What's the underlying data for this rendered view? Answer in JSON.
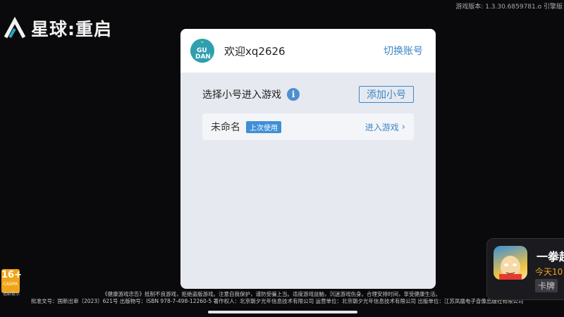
{
  "background": {
    "app_title": "星球:重启",
    "version_text": "游戏版本: 1.3.30.6859781.o  引擎版"
  },
  "dialog": {
    "welcome": "欢迎xq2626",
    "switch_account": "切换账号",
    "avatar_icon": "gudian-logo-icon",
    "section_title": "选择小号进入游戏",
    "info_icon_glyph": "i",
    "add_button": "添加小号",
    "accounts": [
      {
        "name": "未命名",
        "badge": "上次使用",
        "action": "进入游戏",
        "action_icon": "›"
      }
    ]
  },
  "age_rating": {
    "age": "16+",
    "sub": "CADPA",
    "caption": "适龄提示"
  },
  "footer": {
    "line1": "《健康游戏忠告》抵制不良游戏，拒绝盗版游戏。注意自我保护，谨防受骗上当。适度游戏益脑，沉迷游戏伤身。合理安排时间，享受健康生活。",
    "line2": "批准文号：国新出审〔2023〕621号  出版物号：ISBN 978-7-498-12260-5  著作权人：北京朝夕光年信息技术有限公司  运营单位：北京朝夕光年信息技术有限公司  出版单位：江苏凤凰电子音像出版社有限公司"
  },
  "game_card": {
    "name": "一拳超",
    "time": "今天10",
    "tag": "卡牌"
  },
  "colors": {
    "accent": "#3d86c6",
    "badge": "#3f8fd8",
    "age_badge": "#f0a418"
  }
}
